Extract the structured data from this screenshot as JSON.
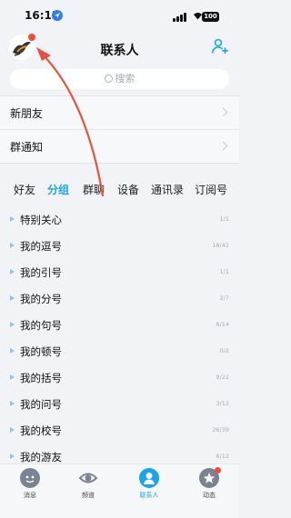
{
  "status": {
    "time": "16:13",
    "battery": "100"
  },
  "header": {
    "title": "联系人"
  },
  "search": {
    "placeholder": "搜索"
  },
  "rows": {
    "new_friends": "新朋友",
    "group_notice": "群通知"
  },
  "tabs": [
    "好友",
    "分组",
    "群聊",
    "设备",
    "通讯录",
    "订阅号"
  ],
  "active_tab": "分组",
  "groups": [
    {
      "label": "特别关心",
      "count": "1/1"
    },
    {
      "label": "我的逗号",
      "count": "18/41"
    },
    {
      "label": "我的引号",
      "count": "1/1"
    },
    {
      "label": "我的分号",
      "count": "2/7"
    },
    {
      "label": "我的句号",
      "count": "6/14"
    },
    {
      "label": "我的顿号",
      "count": "0/2"
    },
    {
      "label": "我的括号",
      "count": "9/22"
    },
    {
      "label": "我的问号",
      "count": "3/12"
    },
    {
      "label": "我的校号",
      "count": "26/39"
    },
    {
      "label": "我的游友",
      "count": "6/12"
    }
  ],
  "nav": [
    {
      "label": "消息",
      "icon": "message-icon"
    },
    {
      "label": "频道",
      "icon": "channel-icon"
    },
    {
      "label": "联系人",
      "icon": "contacts-icon"
    },
    {
      "label": "动态",
      "icon": "feed-icon"
    }
  ],
  "colors": {
    "accent": "#1aa4ec",
    "badge": "#f24b3d",
    "annotation_arrow": "#e5533f"
  }
}
